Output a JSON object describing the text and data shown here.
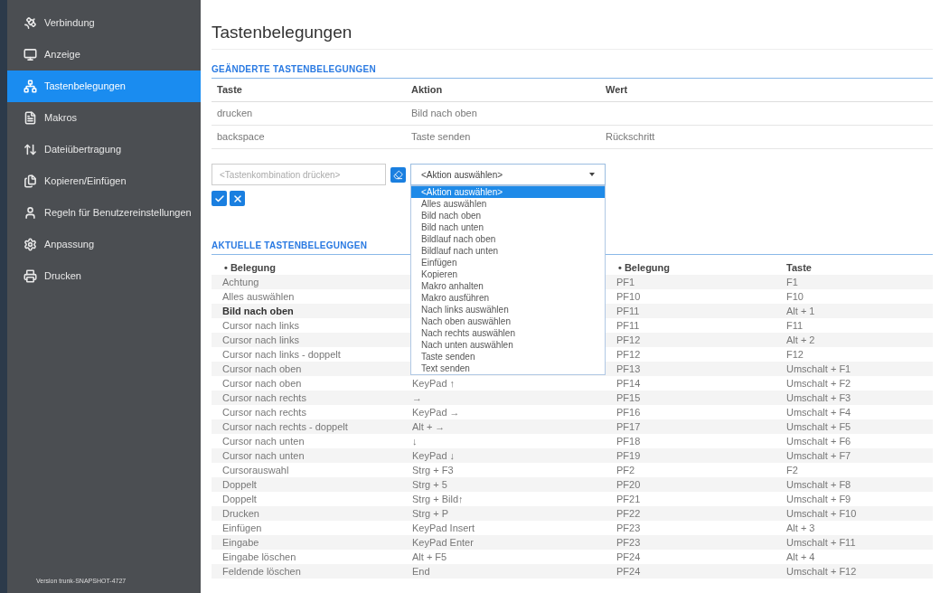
{
  "sidebar": {
    "items": [
      {
        "label": "Verbindung",
        "selected": false
      },
      {
        "label": "Anzeige",
        "selected": false
      },
      {
        "label": "Tastenbelegungen",
        "selected": true
      },
      {
        "label": "Makros",
        "selected": false
      },
      {
        "label": "Dateiübertragung",
        "selected": false
      },
      {
        "label": "Kopieren/Einfügen",
        "selected": false
      },
      {
        "label": "Regeln für Benutzereinstellungen",
        "selected": false
      },
      {
        "label": "Anpassung",
        "selected": false
      },
      {
        "label": "Drucken",
        "selected": false
      }
    ],
    "version": "Version trunk-SNAPSHOT-4727"
  },
  "title": "Tastenbelegungen",
  "changed": {
    "heading": "GEÄNDERTE TASTENBELEGUNGEN",
    "columns": [
      "Taste",
      "Aktion",
      "Wert"
    ],
    "rows": [
      {
        "taste": "drucken",
        "aktion": "Bild nach oben",
        "wert": ""
      },
      {
        "taste": "backspace",
        "aktion": "Taste senden",
        "wert": "Rückschritt"
      }
    ],
    "form": {
      "key_placeholder": "<Tastenkombination drücken>",
      "select_value": "<Aktion auswählen>",
      "options": [
        {
          "label": "<Aktion auswählen>",
          "selected": true
        },
        {
          "label": "Alles auswählen",
          "selected": false
        },
        {
          "label": "Bild nach oben",
          "selected": false
        },
        {
          "label": "Bild nach unten",
          "selected": false
        },
        {
          "label": "Bildlauf nach oben",
          "selected": false
        },
        {
          "label": "Bildlauf nach unten",
          "selected": false
        },
        {
          "label": "Einfügen",
          "selected": false
        },
        {
          "label": "Kopieren",
          "selected": false
        },
        {
          "label": "Makro anhalten",
          "selected": false
        },
        {
          "label": "Makro ausführen",
          "selected": false
        },
        {
          "label": "Nach links auswählen",
          "selected": false
        },
        {
          "label": "Nach oben auswählen",
          "selected": false
        },
        {
          "label": "Nach rechts auswählen",
          "selected": false
        },
        {
          "label": "Nach unten auswählen",
          "selected": false
        },
        {
          "label": "Taste senden",
          "selected": false
        },
        {
          "label": "Text senden",
          "selected": false
        }
      ]
    }
  },
  "current": {
    "heading": "AKTUELLE TASTENBELEGUNGEN",
    "left": {
      "column": "• Belegung",
      "rows": [
        {
          "belegung": "Achtung",
          "changed": false
        },
        {
          "belegung": "Alles auswählen",
          "changed": false
        },
        {
          "belegung": "Bild nach oben",
          "changed": true
        },
        {
          "belegung": "Cursor nach links",
          "changed": false
        },
        {
          "belegung": "Cursor nach links",
          "changed": false
        },
        {
          "belegung": "Cursor nach links - doppelt",
          "changed": false
        },
        {
          "belegung": "Cursor nach oben",
          "changed": false
        },
        {
          "belegung": "Cursor nach oben",
          "taste": "KeyPad ↑",
          "changed": false
        },
        {
          "belegung": "Cursor nach rechts",
          "taste": "→",
          "changed": false
        },
        {
          "belegung": "Cursor nach rechts",
          "taste": "KeyPad →",
          "changed": false
        },
        {
          "belegung": "Cursor nach rechts - doppelt",
          "taste": "Alt + →",
          "changed": false
        },
        {
          "belegung": "Cursor nach unten",
          "taste": "↓",
          "changed": false
        },
        {
          "belegung": "Cursor nach unten",
          "taste": "KeyPad ↓",
          "changed": false
        },
        {
          "belegung": "Cursorauswahl",
          "taste": "Strg + F3",
          "changed": false
        },
        {
          "belegung": "Doppelt",
          "taste": "Strg + 5",
          "changed": false
        },
        {
          "belegung": "Doppelt",
          "taste": "Strg + Bild↑",
          "changed": false
        },
        {
          "belegung": "Drucken",
          "taste": "Strg + P",
          "changed": false
        },
        {
          "belegung": "Einfügen",
          "taste": "KeyPad Insert",
          "changed": false
        },
        {
          "belegung": "Eingabe",
          "taste": "KeyPad Enter",
          "changed": false
        },
        {
          "belegung": "Eingabe löschen",
          "taste": "Alt + F5",
          "changed": false
        },
        {
          "belegung": "Feldende löschen",
          "taste": "End",
          "changed": false
        }
      ]
    },
    "right": {
      "columns": [
        "• Belegung",
        "Taste"
      ],
      "rows": [
        [
          "PF1",
          "F1"
        ],
        [
          "PF10",
          "F10"
        ],
        [
          "PF11",
          "Alt + 1"
        ],
        [
          "PF11",
          "F11"
        ],
        [
          "PF12",
          "Alt + 2"
        ],
        [
          "PF12",
          "F12"
        ],
        [
          "PF13",
          "Umschalt + F1"
        ],
        [
          "PF14",
          "Umschalt + F2"
        ],
        [
          "PF15",
          "Umschalt + F3"
        ],
        [
          "PF16",
          "Umschalt + F4"
        ],
        [
          "PF17",
          "Umschalt + F5"
        ],
        [
          "PF18",
          "Umschalt + F6"
        ],
        [
          "PF19",
          "Umschalt + F7"
        ],
        [
          "PF2",
          "F2"
        ],
        [
          "PF20",
          "Umschalt + F8"
        ],
        [
          "PF21",
          "Umschalt + F9"
        ],
        [
          "PF22",
          "Umschalt + F10"
        ],
        [
          "PF23",
          "Alt + 3"
        ],
        [
          "PF23",
          "Umschalt + F11"
        ],
        [
          "PF24",
          "Alt + 4"
        ],
        [
          "PF24",
          "Umschalt + F12"
        ]
      ]
    }
  }
}
